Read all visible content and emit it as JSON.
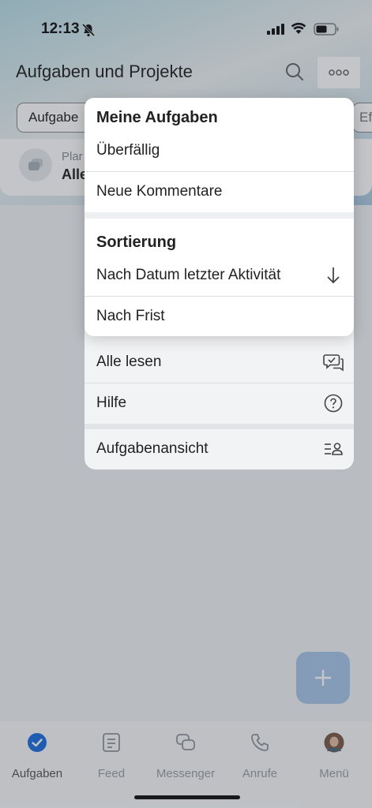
{
  "status": {
    "time": "12:13"
  },
  "header": {
    "title": "Aufgaben und Projekte"
  },
  "filters": {
    "chip_label": "Aufgabe",
    "chip_right_label": "Ef"
  },
  "card": {
    "subtitle": "Plar",
    "title": "Alle"
  },
  "menu": {
    "section1_title": "Meine Aufgaben",
    "section1_items": [
      "Überfällig",
      "Neue Kommentare"
    ],
    "section2_title": "Sortierung",
    "section2_items": [
      "Nach Datum letzter Aktivität",
      "Nach Frist"
    ],
    "actions": [
      "Alle lesen",
      "Hilfe",
      "Aufgabenansicht"
    ]
  },
  "tabs": [
    {
      "label": "Aufgaben",
      "icon": "check-circle-icon"
    },
    {
      "label": "Feed",
      "icon": "newspaper-icon"
    },
    {
      "label": "Messenger",
      "icon": "chat-bubbles-icon"
    },
    {
      "label": "Anrufe",
      "icon": "phone-icon"
    },
    {
      "label": "Menü",
      "icon": "avatar"
    }
  ],
  "colors": {
    "accent": "#1e6fe0",
    "fab": "#a9c7e9"
  }
}
